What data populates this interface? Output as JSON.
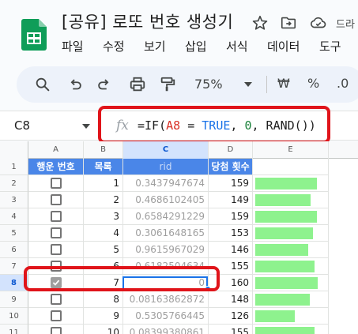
{
  "app": {
    "title": "[공유] 로또 번호 생성기",
    "drive_label": "드라",
    "accent_color": "#0f9d58",
    "highlight_color": "#e0141a"
  },
  "menu": [
    "파일",
    "수정",
    "보기",
    "삽입",
    "서식",
    "데이터",
    "도구"
  ],
  "toolbar": {
    "icons": [
      "search-icon",
      "undo-icon",
      "redo-icon",
      "print-icon",
      "paint-format-icon"
    ],
    "zoom": "75%",
    "currency": "₩",
    "percent": "%",
    "decimal": ".0"
  },
  "formula_bar": {
    "cell_ref": "C8",
    "fx": "fx",
    "formula": {
      "prefix": "=IF(",
      "ref": "A8",
      "mid1": " = ",
      "bool": "TRUE",
      "mid2": ", ",
      "zero": "0",
      "tail": ", RAND())"
    }
  },
  "grid": {
    "columns": [
      "A",
      "B",
      "C",
      "D",
      "E"
    ],
    "selected_column": "C",
    "selected_row": "8",
    "header_row": {
      "row": "1",
      "a": "행운 번호",
      "b": "목록",
      "c": "rid",
      "d": "당첨 횟수"
    },
    "rows": [
      {
        "row": "2",
        "checked": false,
        "b": "1",
        "c": "0.3437947674",
        "d": "159",
        "fill": 0.93
      },
      {
        "row": "3",
        "checked": false,
        "b": "2",
        "c": "0.4686102405",
        "d": "149",
        "fill": 0.83
      },
      {
        "row": "4",
        "checked": false,
        "b": "3",
        "c": "0.6584291229",
        "d": "159",
        "fill": 0.93
      },
      {
        "row": "5",
        "checked": false,
        "b": "4",
        "c": "0.3061648165",
        "d": "153",
        "fill": 0.87
      },
      {
        "row": "6",
        "checked": false,
        "b": "5",
        "c": "0.9615967029",
        "d": "146",
        "fill": 0.8
      },
      {
        "row": "7",
        "checked": false,
        "b": "6",
        "c": "0.6182504634",
        "d": "155",
        "fill": 0.89
      },
      {
        "row": "8",
        "checked": true,
        "b": "7",
        "c": "0",
        "d": "160",
        "fill": 0.94
      },
      {
        "row": "9",
        "checked": false,
        "b": "8",
        "c": "0.08163862872",
        "d": "148",
        "fill": 0.82
      },
      {
        "row": "10",
        "checked": false,
        "b": "9",
        "c": "0.5305766445",
        "d": "126",
        "fill": 0.6
      },
      {
        "row": "11",
        "checked": false,
        "b": "10",
        "c": "0.08399380861",
        "d": "155",
        "fill": 0.89
      }
    ],
    "bar_color": "#8ef28e",
    "header_color": "#4a86e8"
  }
}
